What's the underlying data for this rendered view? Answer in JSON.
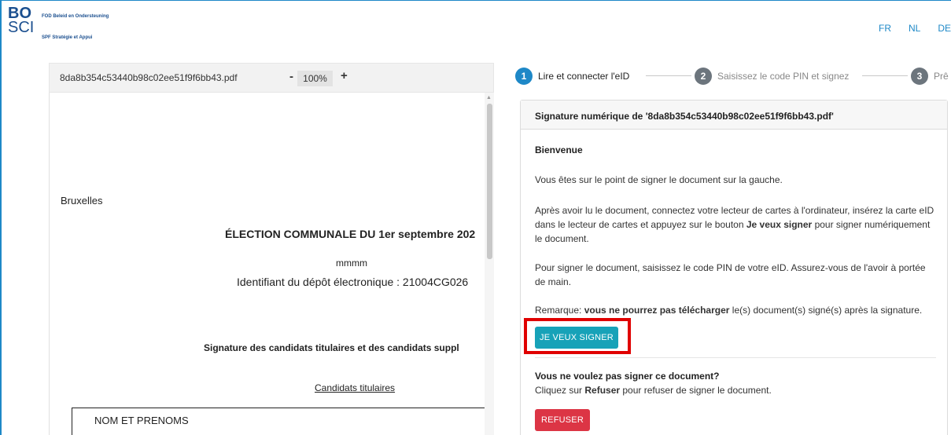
{
  "header": {
    "logo_top": "BO",
    "logo_bottom": "SCI",
    "org_nl": "FOD Beleid en Ondersteuning",
    "org_fr": "SPF Stratégie et Appui",
    "languages": [
      "FR",
      "NL",
      "DE"
    ]
  },
  "pdf": {
    "filename": "8da8b354c53440b98c02ee51f9f6bb43.pdf",
    "zoom_minus": "-",
    "zoom": "100%",
    "zoom_plus": "+",
    "content": {
      "city": "Bruxelles",
      "title": "ÉLECTION COMMUNALE DU 1er septembre 202",
      "name": "mmmm",
      "deposit_id": "Identifiant du dépôt électronique : 21004CG026",
      "signature_heading": "Signature des candidats titulaires et des candidats suppl",
      "candidates_label": "Candidats titulaires",
      "table_header": "NOM ET PRENOMS"
    }
  },
  "stepper": {
    "steps": [
      {
        "number": "1",
        "label": "Lire et connecter l'eID"
      },
      {
        "number": "2",
        "label": "Saisissez le code PIN et signez"
      },
      {
        "number": "3",
        "label": "Prê"
      }
    ],
    "active_color": "#1e88c7",
    "inactive_color": "#6c757d"
  },
  "card": {
    "header": "Signature numérique de '8da8b354c53440b98c02ee51f9f6bb43.pdf'",
    "welcome": "Bienvenue",
    "intro": "Vous êtes sur le point de signer le document sur la gauche.",
    "instructions_pre": "Après avoir lu le document, connectez votre lecteur de cartes à l'ordinateur, insérez la carte eID dans le lecteur de cartes et appuyez sur le bouton ",
    "instructions_bold": "Je veux signer",
    "instructions_post": " pour signer numériquement le document.",
    "pin_info": "Pour signer le document, saisissez le code PIN de votre eID. Assurez-vous de l'avoir à portée de main.",
    "remark_pre": "Remarque: ",
    "remark_bold": "vous ne pourrez pas télécharger",
    "remark_post": " le(s) document(s) signé(s) après la signature.",
    "sign_button": "JE VEUX SIGNER",
    "refuse_heading": "Vous ne voulez pas signer ce document?",
    "refuse_pre": "Cliquez sur ",
    "refuse_bold": "Refuser",
    "refuse_post": " pour refuser de signer le document.",
    "refuse_button": "REFUSER"
  },
  "colors": {
    "brand": "#1b4f8f",
    "link": "#1e88c7",
    "sign_button": "#17a2b8",
    "refuse_button": "#dc3545",
    "highlight": "#e00000"
  }
}
